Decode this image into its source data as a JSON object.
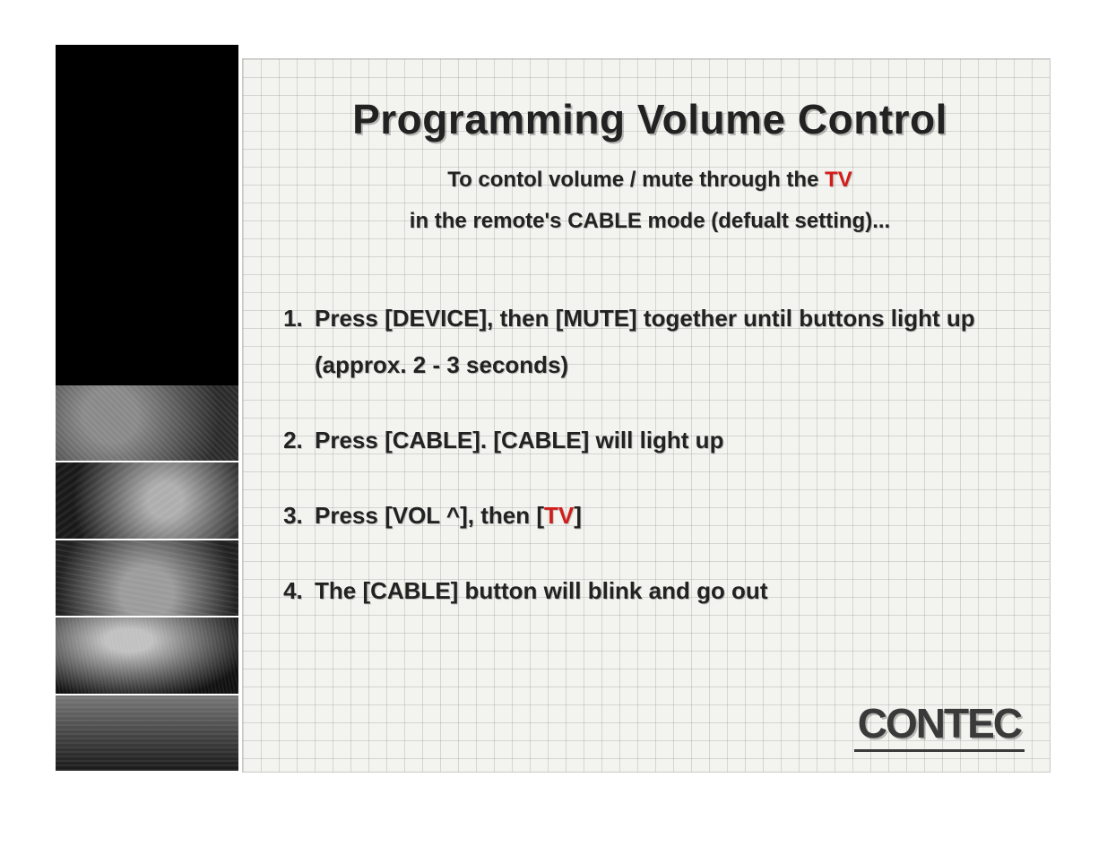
{
  "title": "Programming Volume Control",
  "subtitle": {
    "line1_pre": "To contol volume / mute through the ",
    "line1_em": "TV",
    "line2": "in the remote's CABLE mode (defualt setting)..."
  },
  "steps": {
    "1": "Press [DEVICE], then [MUTE] together until buttons light up (approx. 2 - 3 seconds)",
    "2": "Press [CABLE].  [CABLE] will light up",
    "3_pre": "Press [VOL ^], then [",
    "3_em": "TV",
    "3_post": "]",
    "4": "The [CABLE] button will blink and go out"
  },
  "logo_text": "CONTEC",
  "colors": {
    "emphasis_red": "#d21e1b"
  }
}
